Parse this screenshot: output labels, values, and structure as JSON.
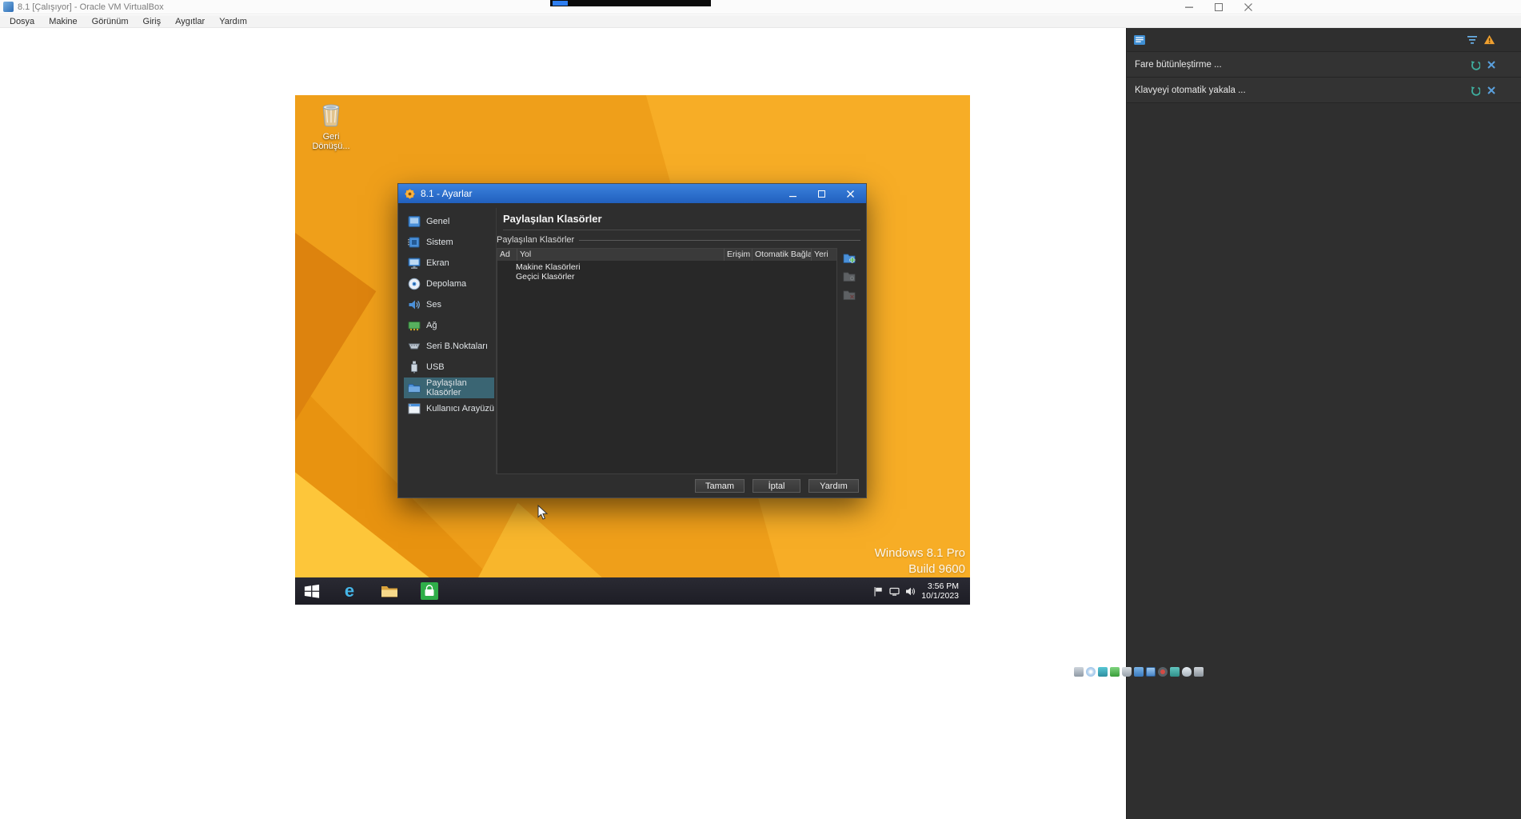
{
  "titlebar": {
    "title": "8.1 [Çalışıyor] - Oracle VM VirtualBox"
  },
  "menubar": {
    "items": [
      {
        "label": "Dosya"
      },
      {
        "label": "Makine"
      },
      {
        "label": "Görünüm"
      },
      {
        "label": "Giriş"
      },
      {
        "label": "Aygıtlar"
      },
      {
        "label": "Yardım"
      }
    ]
  },
  "notification_panel": {
    "rows": [
      {
        "label": "Fare bütünleştirme ...",
        "actions": [
          "undo-icon",
          "close-icon"
        ]
      },
      {
        "label": "Klavyeyi otomatik yakala ...",
        "actions": [
          "undo-icon",
          "close-icon"
        ]
      }
    ],
    "header_icons": [
      "notifications-log-icon",
      "filter-icon",
      "warning-icon"
    ]
  },
  "desktop": {
    "recycle_bin": {
      "line1": "Geri",
      "line2": "Dönüşü..."
    },
    "watermark": {
      "line1": "Windows 8.1 Pro",
      "line2": "Build 9600"
    },
    "taskbar": {
      "time": "3:56 PM",
      "date": "10/1/2023"
    }
  },
  "dialog": {
    "title": "8.1 - Ayarlar",
    "nav": [
      {
        "label": "Genel",
        "icon": "general-icon"
      },
      {
        "label": "Sistem",
        "icon": "system-icon"
      },
      {
        "label": "Ekran",
        "icon": "display-icon"
      },
      {
        "label": "Depolama",
        "icon": "storage-icon"
      },
      {
        "label": "Ses",
        "icon": "audio-icon"
      },
      {
        "label": "Ağ",
        "icon": "network-icon"
      },
      {
        "label": "Seri B.Noktaları",
        "icon": "serial-ports-icon"
      },
      {
        "label": "USB",
        "icon": "usb-icon"
      },
      {
        "label": "Paylaşılan Klasörler",
        "icon": "shared-folders-icon",
        "selected": true
      },
      {
        "label": "Kullanıcı Arayüzü",
        "icon": "user-interface-icon"
      }
    ],
    "page_title": "Paylaşılan Klasörler",
    "group_label": "Paylaşılan Klasörler",
    "table": {
      "columns": [
        {
          "label": "Ad"
        },
        {
          "label": "Yol"
        },
        {
          "label": "Erişim"
        },
        {
          "label": "Otomatik Bağla"
        },
        {
          "label": "Yeri"
        }
      ],
      "rows": [
        {
          "label": "Makine Klasörleri"
        },
        {
          "label": "Geçici Klasörler"
        }
      ],
      "toolbar_icons": [
        "add-shared-folder-icon",
        "edit-shared-folder-icon",
        "remove-shared-folder-icon"
      ]
    },
    "buttons": [
      {
        "label": "Tamam"
      },
      {
        "label": "İptal"
      },
      {
        "label": "Yardım"
      }
    ]
  },
  "status_bar_icons": [
    "hdd-icon",
    "optical-disk-icon",
    "audio-icon",
    "network-icon",
    "usb-icon",
    "shared-folders-icon",
    "display-icon",
    "recording-icon",
    "features-icon",
    "mouse-icon",
    "keyboard-icon"
  ],
  "icons": {
    "ie_glyph": "e"
  },
  "colors": {
    "dialog_titlebar_blue": "#2f74d2",
    "nav_selected_teal": "#3a6573",
    "wallpaper_orange": "#ef9f1a",
    "taskbar_dark": "#21212a",
    "panel_dark": "#2f2f2f"
  }
}
